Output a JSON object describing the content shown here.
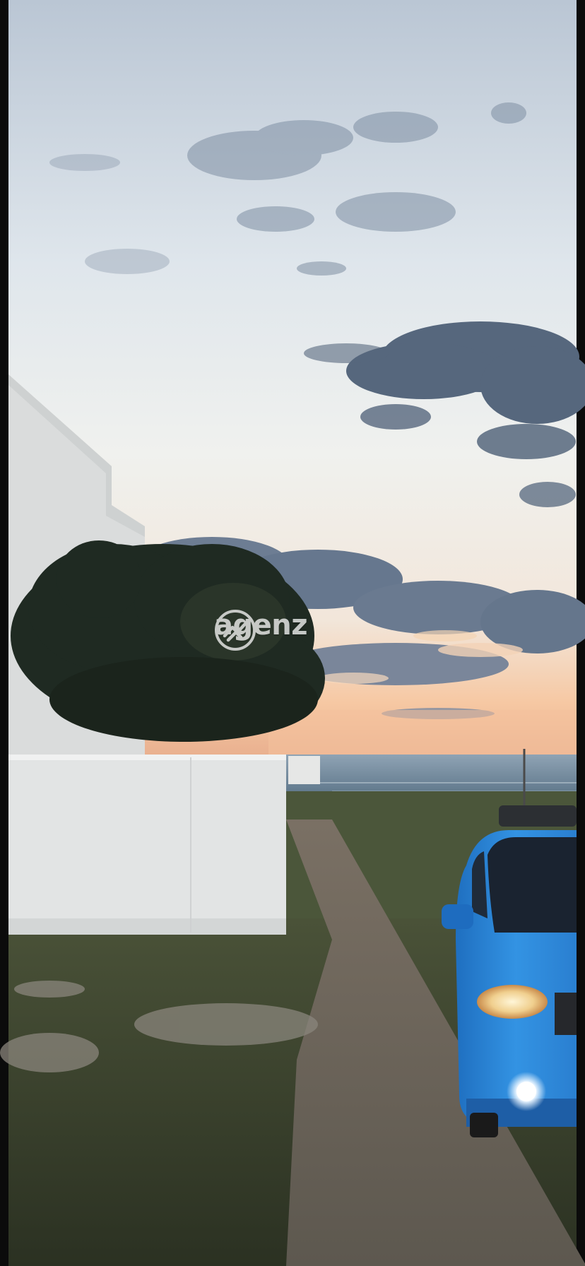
{
  "scene": {
    "description_free": true,
    "watermark": {
      "text": "agenz",
      "icon": "agenz-logo-icon"
    },
    "colors": {
      "sky_top": "#c9d4e0",
      "sky_mid": "#e6ecf0",
      "sunset": "#f3c9a3",
      "sea": "#5f7f96",
      "car": "#2f86d6",
      "wall": "#e3e5e6",
      "grass": "#3d4a2f",
      "road": "#6b655d"
    }
  }
}
